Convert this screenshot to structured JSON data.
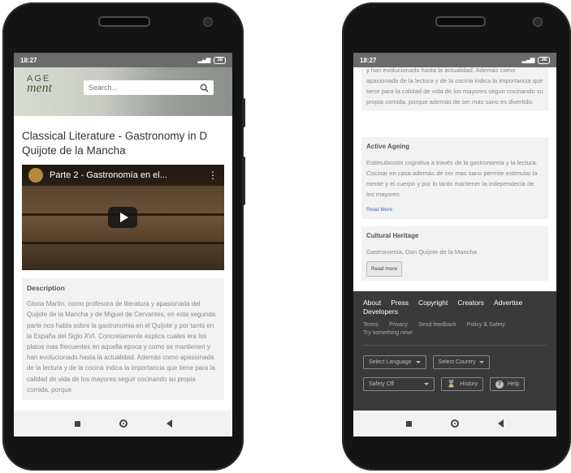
{
  "status": {
    "time": "18:27",
    "battery": "38"
  },
  "left": {
    "logo": {
      "line1": "AGE",
      "line2": "ment"
    },
    "search": {
      "placeholder": "Search..."
    },
    "title": "Classical Literature - Gastronomy in D Quijote de la Mancha",
    "video": {
      "title": "Parte 2 - Gastronomía en el..."
    },
    "description": {
      "label": "Description",
      "text": "Gloria Martín, como profesora de literatura y apasionada del Quijote de la Mancha y de Miguel de Cervantes, en esta segunda parte nos habla sobre la gastronomia en el Quijote y por tanto en la España del Siglo XVI. Concretamente explica cuales era los platos mas frecuentes en aquella epoca y como se mantienen y han evolucionado hasta la actualidad. Además como apasionada de la lectura y de la cocina indica la importancia que tiene para la calidad de vida de los mayores seguir cocinando su propia comida, porque"
    }
  },
  "right": {
    "card1_text": "y han evolucionado hasta la actualidad. Además como apasionada de la lectura y de la cocina indica la importancia que tiene para la calidad de vida de los mayores seguir cocinando su propia comida, porque además de ser mas sano es divertido.",
    "active_ageing": {
      "title": "Active Ageing",
      "text": "Estimulacoón cognitiva a través de la gastronomía y la lectura. Cocinar en casa además de ser mas sano permite estimular la mente y el cuerpo y por lo tanto mantener la independecia de los mayores",
      "read_more": "Read More"
    },
    "cultural_heritage": {
      "title": "Cultural Heritage",
      "text": "Gastronomía, Don Quijote de la Mancha",
      "read_more": "Read more"
    },
    "footer": {
      "links": [
        "About",
        "Press",
        "Copyright",
        "Creators",
        "Advertise",
        "Developers"
      ],
      "small_links": [
        "Terms",
        "Privacy",
        "Send feedback",
        "Policy & Safety",
        "Try something new!"
      ],
      "select_language": "Select Language",
      "select_country": "Select Country",
      "safety": "Safety Off",
      "history": "History",
      "help": "Help"
    }
  }
}
